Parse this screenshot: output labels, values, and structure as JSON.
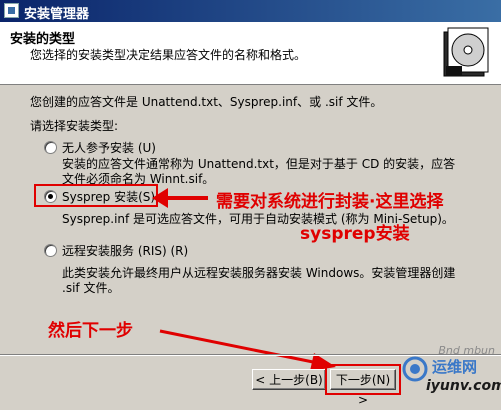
{
  "window": {
    "title": "安装管理器"
  },
  "header": {
    "title": "安装的类型",
    "description": "您选择的安装类型决定结果应答文件的名称和格式。"
  },
  "body": {
    "intro": "您创建的应答文件是 Unattend.txt、Sysprep.inf、或 .sif 文件。",
    "prompt": "请选择安装类型:"
  },
  "options": [
    {
      "label": "无人参予安装 (U)",
      "desc_line1": "安装的应答文件通常称为 Unattend.txt，但是对于基于 CD 的安装，应答",
      "desc_line2": "文件必须命名为 Winnt.sif。",
      "selected": false
    },
    {
      "label": "Sysprep 安装(S)",
      "desc_line1": "Sysprep.inf 是可选应答文件，可用于自动安装模式 (称为 Mini-Setup)。",
      "selected": true
    },
    {
      "label": "远程安装服务 (RIS) (R)",
      "desc_line1": "此类安装允许最终用户从远程安装服务器安装 Windows。安装管理器创建",
      "desc_line2": ".sif 文件。",
      "selected": false
    }
  ],
  "buttons": {
    "back": "< 上一步(B)",
    "next": "下一步(N) >"
  },
  "annotations": {
    "note1": "需要对系统进行封装·这里选择",
    "note2": "sysprep安装",
    "note3": "然后下一步",
    "color": "#e00000"
  },
  "watermark": {
    "site_cn": "运维网",
    "site_url": "iyunv.com",
    "faint": "Bnd mbun"
  }
}
